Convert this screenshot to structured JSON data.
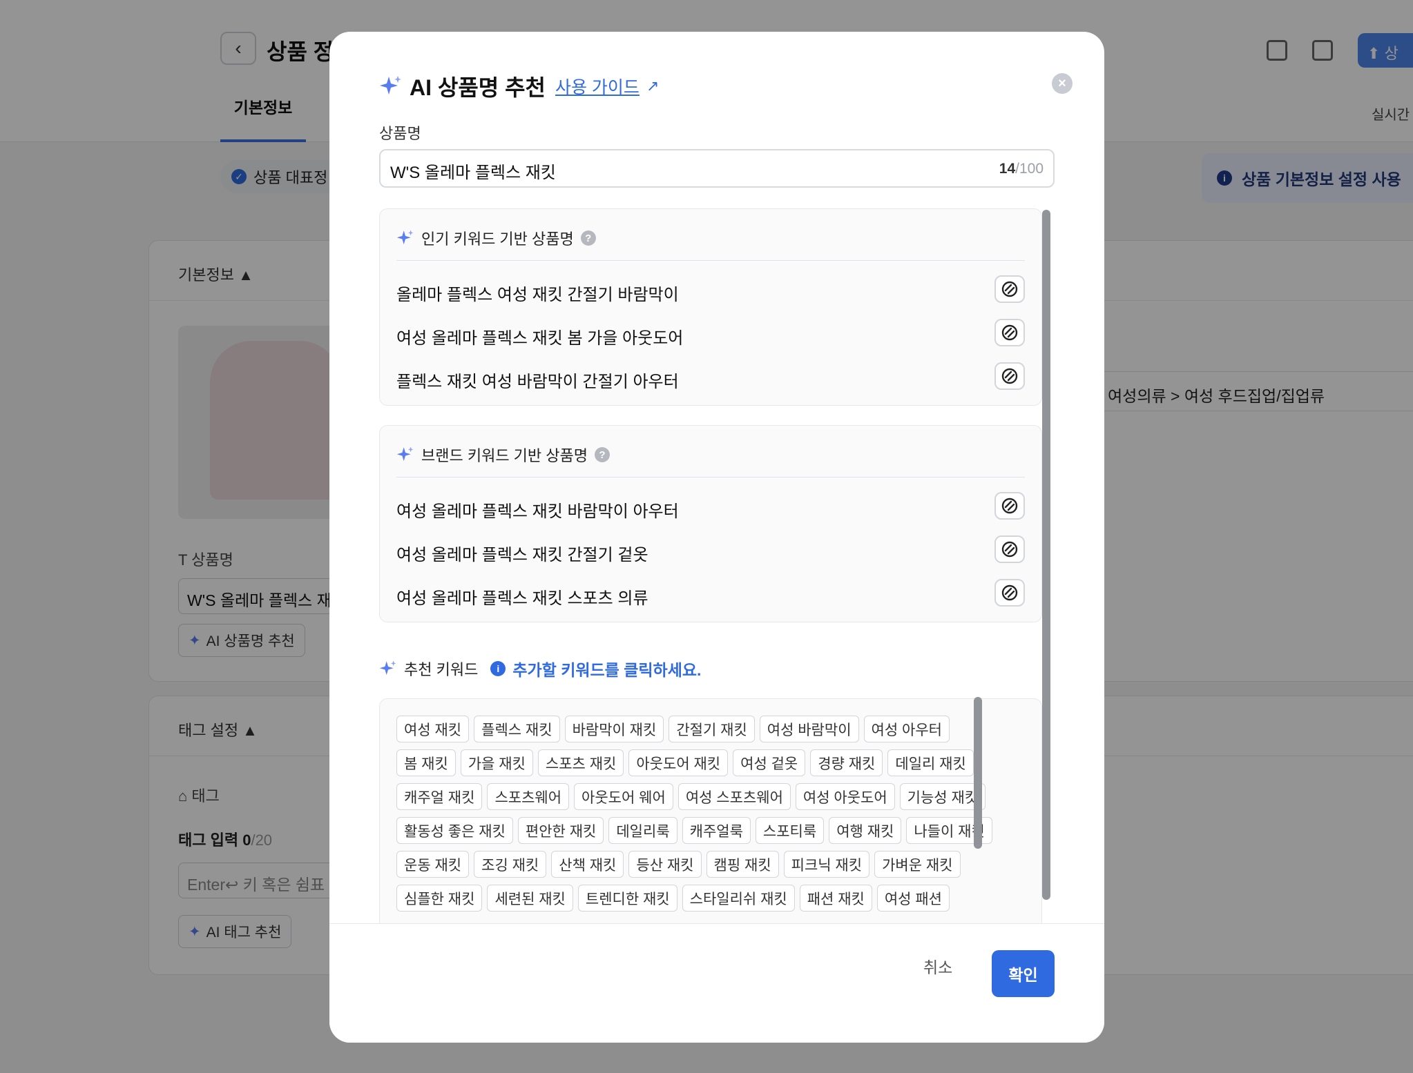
{
  "background": {
    "page_title": "상품 정",
    "tab_label": "기본정보",
    "realtime_label": "실시간",
    "status_chip": "상품 대표정",
    "info_banner": "상품 기본정보 설정 사용",
    "upload_label": "상",
    "section_basic": "기본정보 ▲",
    "product_name_label": "상품명",
    "product_name_value": "W'S 올레마 플렉스 재",
    "ai_name_button": "AI 상품명 추천",
    "category_path": "여성의류 > 여성 후드집업/집업류",
    "section_tag": "태그 설정 ▲",
    "tag_label": "태그",
    "tag_input_label": "태그 입력",
    "tag_count": "0",
    "tag_max": "/20",
    "tag_placeholder": "Enter↩ 키 혹은 쉼표",
    "ai_tag_button": "AI 태그 추천"
  },
  "modal": {
    "title": "AI 상품명 추천",
    "guide_link": "사용 가이드",
    "field_label": "상품명",
    "input_value": "W'S 올레마 플렉스 재킷",
    "char_count": "14",
    "char_max": "/100",
    "popular_section": {
      "title": "인기 키워드 기반 상품명",
      "items": [
        "올레마 플렉스 여성 재킷 간절기 바람막이",
        "여성 올레마 플렉스 재킷 봄 가을 아웃도어",
        "플렉스 재킷 여성 바람막이 간절기 아우터"
      ]
    },
    "brand_section": {
      "title": "브랜드 키워드 기반 상품명",
      "items": [
        "여성 올레마 플렉스 재킷 바람막이 아우터",
        "여성 올레마 플렉스 재킷 간절기 겉옷",
        "여성 올레마 플렉스 재킷 스포츠 의류"
      ]
    },
    "keyword_section": {
      "title": "추천 키워드",
      "hint": "추가할 키워드를 클릭하세요.",
      "keywords": [
        "여성 재킷",
        "플렉스 재킷",
        "바람막이 재킷",
        "간절기 재킷",
        "여성 바람막이",
        "여성 아우터",
        "봄 재킷",
        "가을 재킷",
        "스포츠 재킷",
        "아웃도어 재킷",
        "여성 겉옷",
        "경량 재킷",
        "데일리 재킷",
        "캐주얼 재킷",
        "스포츠웨어",
        "아웃도어 웨어",
        "여성 스포츠웨어",
        "여성 아웃도어",
        "기능성 재킷",
        "활동성 좋은 재킷",
        "편안한 재킷",
        "데일리룩",
        "캐주얼룩",
        "스포티룩",
        "여행 재킷",
        "나들이 재킷",
        "운동 재킷",
        "조깅 재킷",
        "산책 재킷",
        "등산 재킷",
        "캠핑 재킷",
        "피크닉 재킷",
        "가벼운 재킷",
        "심플한 재킷",
        "세련된 재킷",
        "트렌디한 재킷",
        "스타일리쉬 재킷",
        "패션 재킷",
        "여성 패션"
      ]
    },
    "cancel_label": "취소",
    "confirm_label": "확인"
  },
  "colors": {
    "accent": "#2f6ae0",
    "sparkle": "#5b7cf0",
    "overlay": "rgba(0,0,0,0.42)"
  }
}
